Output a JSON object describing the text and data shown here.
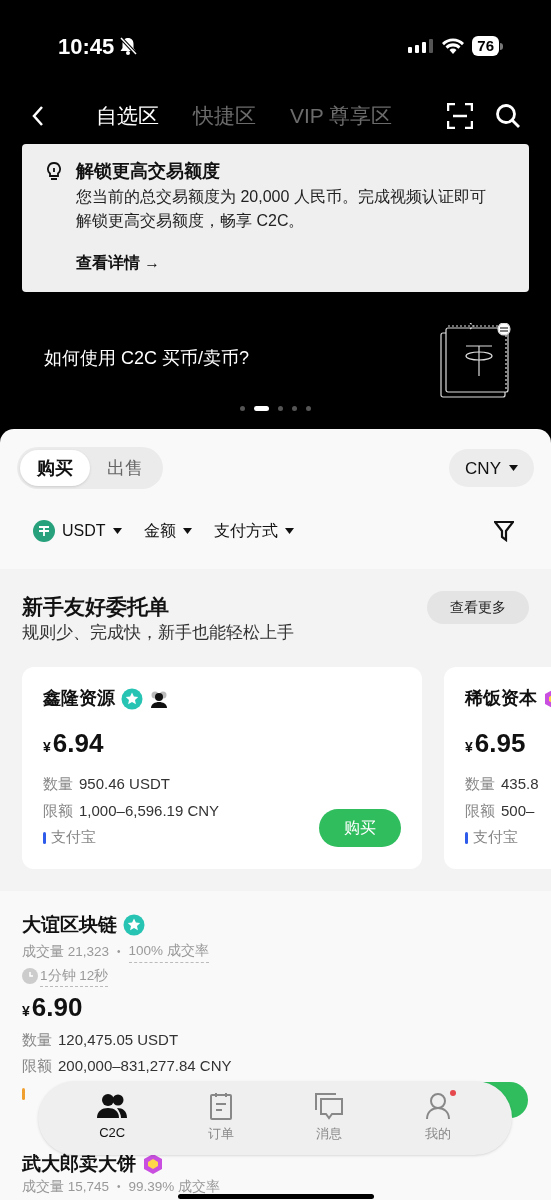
{
  "status_bar": {
    "time": "10:45",
    "battery": "76"
  },
  "header": {
    "tabs": [
      {
        "label": "自选区",
        "selected": true
      },
      {
        "label": "快捷区",
        "selected": false
      },
      {
        "label": "VIP 尊享区",
        "selected": false
      }
    ]
  },
  "notice": {
    "title": "解锁更高交易额度",
    "body": "您当前的总交易额度为 20,000 人民币。完成视频认证即可解锁更高交易额度，畅享 C2C。",
    "link": "查看详情",
    "link_arrow": "→"
  },
  "banner": {
    "text": "如何使用 C2C 买币/卖币?",
    "dots": [
      {
        "selected": false
      },
      {
        "selected": true
      },
      {
        "selected": false
      },
      {
        "selected": false
      },
      {
        "selected": false
      }
    ]
  },
  "trade_toggle": [
    {
      "label": "购买",
      "selected": true
    },
    {
      "label": "出售",
      "selected": false
    }
  ],
  "currency": "CNY",
  "filters": [
    {
      "label": "USDT",
      "coin": true
    },
    {
      "label": "金额",
      "coin": false
    },
    {
      "label": "支付方式",
      "coin": false
    }
  ],
  "featured": {
    "title": "新手友好委托单",
    "subtitle": "规则少、完成快，新手也能轻松上手",
    "more": "查看更多",
    "cards": [
      {
        "name": "鑫隆资源",
        "kind": "star",
        "group": true,
        "currency": "¥",
        "price": "6.94",
        "qty_label": "数量",
        "qty": "950.46 USDT",
        "limit_label": "限额",
        "limit": "1,000–6,596.19 CNY",
        "payment": "支付宝",
        "color": "#2f5bea",
        "button": "购买"
      },
      {
        "name": "稀饭资本",
        "kind": "hexagon",
        "currency": "¥",
        "price": "6.95",
        "qty_label": "数量",
        "qty": "435.8",
        "limit_label": "限额",
        "limit": "500–",
        "payment": "支付宝",
        "color": "#2f5bea"
      }
    ]
  },
  "listings": [
    {
      "name": "大谊区块链",
      "kind": "star",
      "volume": "成交量 21,323",
      "separator": "•",
      "rate": "100% 成交率",
      "time": "1分钟 12秒",
      "currency": "¥",
      "price": "6.90",
      "qty_label": "数量",
      "qty": "120,475.05 USDT",
      "limit_label": "限额",
      "limit": "200,000–831,277.84 CNY",
      "color": "#f0a030"
    },
    {
      "name": "武大郎卖大饼",
      "kind": "hexagon",
      "volume": "成交量 15,745",
      "separator": "•",
      "rate": "99.39% 成交率"
    }
  ],
  "bottom_nav": [
    {
      "label": "C2C",
      "selected": true,
      "dot": false
    },
    {
      "label": "订单",
      "selected": false,
      "dot": false
    },
    {
      "label": "消息",
      "selected": false,
      "dot": false
    },
    {
      "label": "我的",
      "selected": false,
      "dot": true
    }
  ]
}
